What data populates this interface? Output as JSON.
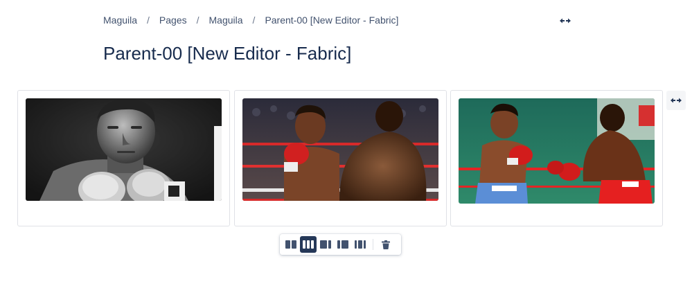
{
  "breadcrumb": [
    {
      "label": "Maguila"
    },
    {
      "label": "Pages"
    },
    {
      "label": "Maguila"
    },
    {
      "label": "Parent-00 [New Editor - Fabric]"
    }
  ],
  "breadcrumb_separator": "/",
  "page": {
    "title": "Parent-00 [New Editor - Fabric]"
  },
  "icons": {
    "width_toggle": "expand-width-icon",
    "toolbar": [
      "two-equal-columns-icon",
      "three-equal-columns-icon",
      "right-sidebar-icon",
      "left-sidebar-icon",
      "three-columns-with-sidebars-icon",
      "trash-icon"
    ]
  },
  "toolbar": {
    "active_layout": "three-equal-columns"
  },
  "columns": [
    {
      "image": "black-and-white boxer portrait"
    },
    {
      "image": "boxers fighting, red gloves"
    },
    {
      "image": "boxers exchanging punches in ring"
    }
  ],
  "colors": {
    "text": "#172b4d",
    "breadcrumb": "#42526e",
    "border": "#dfe1e6",
    "toolbar_active": "#253858"
  }
}
